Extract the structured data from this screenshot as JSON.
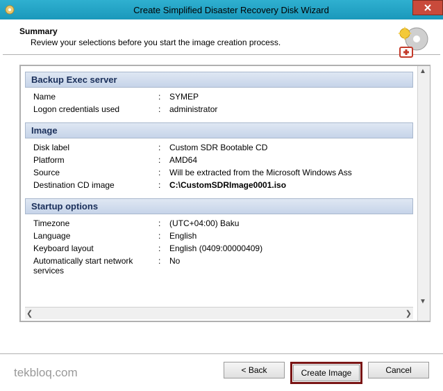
{
  "titlebar": {
    "title": "Create Simplified Disaster Recovery Disk Wizard"
  },
  "header": {
    "title": "Summary",
    "subtitle": "Review your selections before you start the image creation process."
  },
  "sections": {
    "backup": {
      "heading": "Backup Exec server",
      "name_label": "Name",
      "name_value": "SYMEP",
      "logon_label": "Logon credentials used",
      "logon_value": "administrator"
    },
    "image": {
      "heading": "Image",
      "disk_label_label": "Disk label",
      "disk_label_value": "Custom SDR Bootable CD",
      "platform_label": "Platform",
      "platform_value": "AMD64",
      "source_label": "Source",
      "source_value": "Will be extracted from the Microsoft Windows Ass",
      "dest_label": "Destination CD image",
      "dest_value": "C:\\CustomSDRImage0001.iso"
    },
    "startup": {
      "heading": "Startup options",
      "tz_label": "Timezone",
      "tz_value": "(UTC+04:00) Baku",
      "lang_label": "Language",
      "lang_value": "English",
      "kb_label": "Keyboard layout",
      "kb_value": "English (0409:00000409)",
      "auto_label": "Automatically start network services",
      "auto_value": "No"
    }
  },
  "footer": {
    "watermark": "tekbloq.com",
    "back": "< Back",
    "create": "Create Image",
    "cancel": "Cancel"
  }
}
